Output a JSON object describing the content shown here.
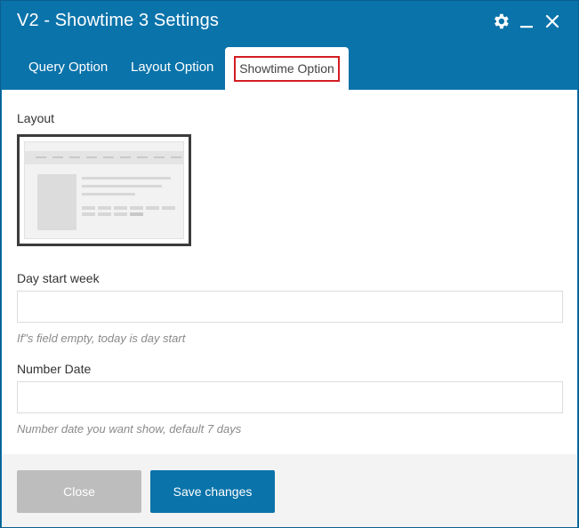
{
  "window": {
    "title": "V2 - Showtime 3 Settings",
    "icons": [
      "gear-icon",
      "minimize-icon",
      "close-icon"
    ]
  },
  "tabs": [
    {
      "label": "Query Option",
      "active": false
    },
    {
      "label": "Layout Option",
      "active": false
    },
    {
      "label": "Showtime Option",
      "active": true
    }
  ],
  "form": {
    "layout_label": "Layout",
    "day_start_label": "Day start week",
    "day_start_value": "",
    "day_start_hint": "If\"s field empty, today is day start",
    "number_date_label": "Number Date",
    "number_date_value": "",
    "number_date_hint": "Number date you want show, default 7 days"
  },
  "footer": {
    "close_label": "Close",
    "save_label": "Save changes"
  },
  "colors": {
    "header_bg": "#0a73aa",
    "highlight_border": "#d11d22",
    "close_btn_bg": "#bdbdbd",
    "save_btn_bg": "#0a73aa"
  }
}
